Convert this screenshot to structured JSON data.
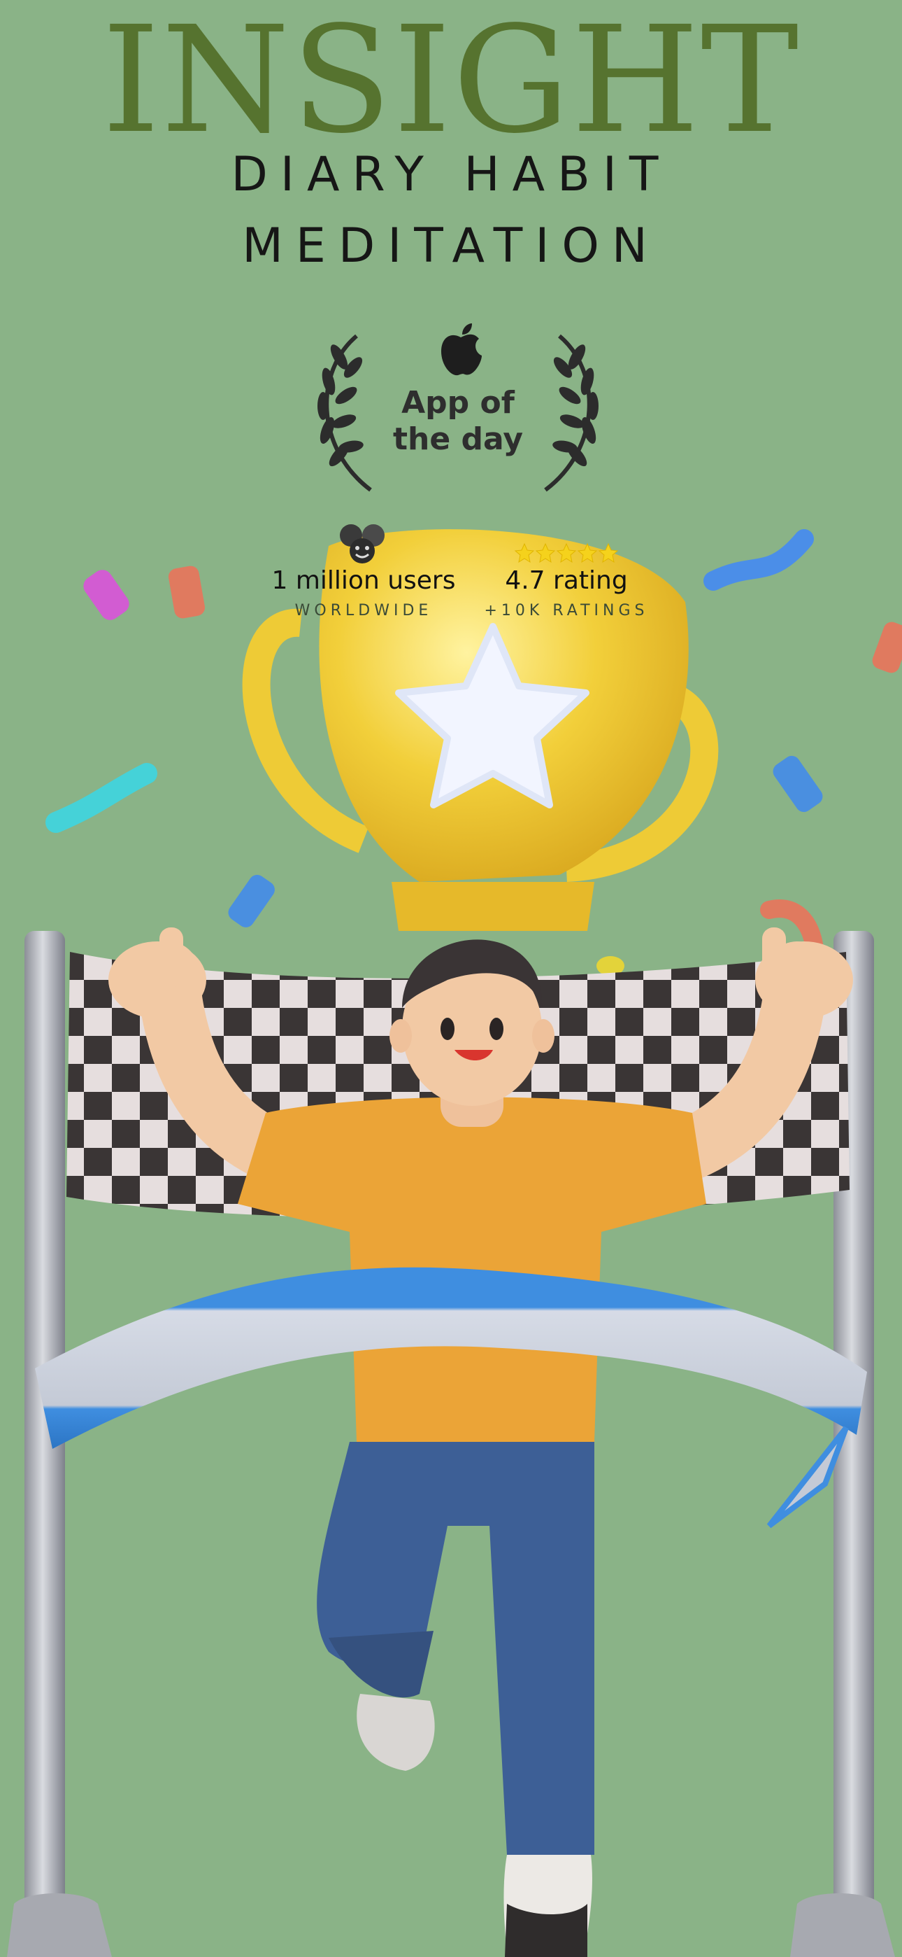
{
  "brand": {
    "title": "INSIGHT",
    "tagline_line1": "DIARY HABIT",
    "tagline_line2": "MEDITATION"
  },
  "award": {
    "line1": "App of",
    "line2": "the day",
    "icon": "apple-icon"
  },
  "stats": [
    {
      "value": "1 million users",
      "caption": "WORLDWIDE",
      "icon": "users-faces-icon"
    },
    {
      "value": "4.7 rating",
      "caption": "+10K RATINGS",
      "icon": "five-stars-icon",
      "stars": 5
    }
  ],
  "colors": {
    "background": "#8ab387",
    "brand": "#56732f",
    "trophy": "#f2cf3a",
    "shirt": "#eba437",
    "pants": "#3d5f96",
    "ribbon": "#3f8ee0"
  }
}
